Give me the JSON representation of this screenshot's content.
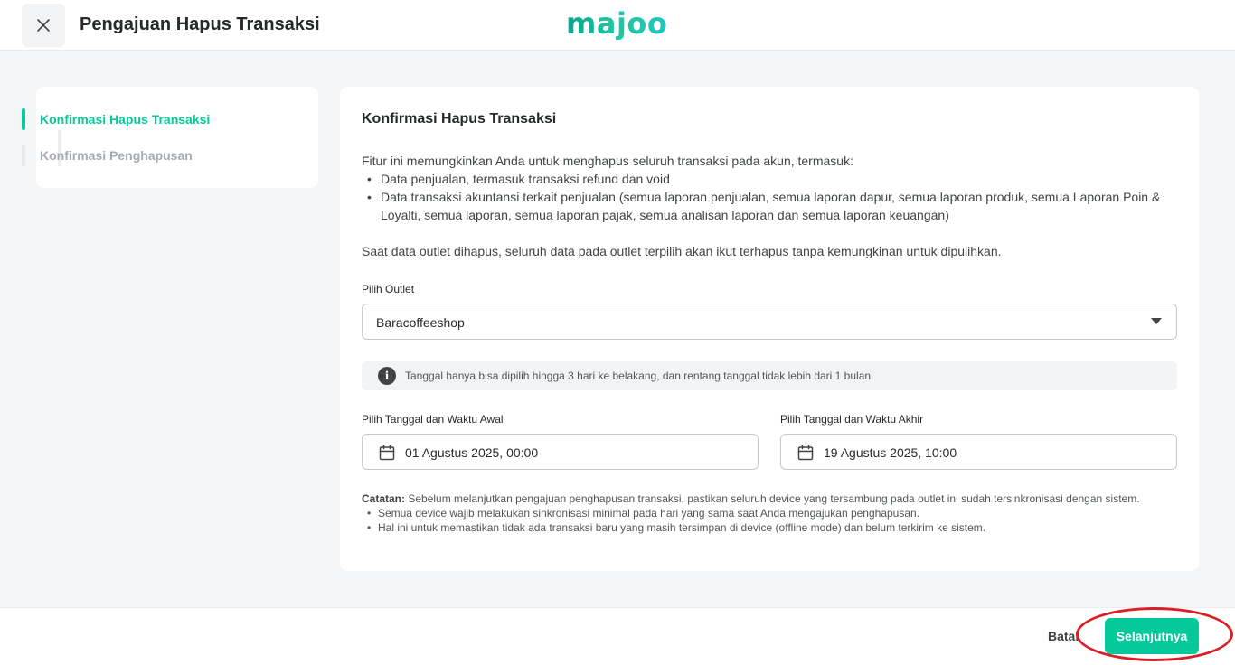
{
  "header": {
    "title": "Pengajuan Hapus Transaksi",
    "logo_text": "majoo",
    "brand_color": "#04c99b"
  },
  "stepper": {
    "steps": [
      {
        "label": "Konfirmasi Hapus Transaksi",
        "active": true
      },
      {
        "label": "Konfirmasi Penghapusan",
        "active": false
      }
    ]
  },
  "main": {
    "title": "Konfirmasi Hapus Transaksi",
    "intro": "Fitur ini memungkinkan Anda untuk menghapus seluruh transaksi pada akun, termasuk:",
    "bullets": [
      "Data penjualan, termasuk transaksi refund dan void",
      "Data transaksi akuntansi terkait penjualan (semua laporan penjualan, semua laporan dapur, semua laporan produk, semua Laporan Poin & Loyalti, semua laporan, semua laporan pajak, semua analisan laporan dan semua laporan keuangan)"
    ],
    "warning": "Saat data outlet dihapus, seluruh data pada outlet terpilih akan ikut terhapus tanpa kemungkinan untuk dipulihkan.",
    "outlet": {
      "label": "Pilih Outlet",
      "value": "Baracoffeeshop"
    },
    "info_banner": "Tanggal hanya bisa dipilih hingga 3 hari ke belakang, dan rentang tanggal tidak lebih dari 1 bulan",
    "start": {
      "label": "Pilih Tanggal dan Waktu Awal",
      "value": "01 Agustus 2025, 00:00"
    },
    "end": {
      "label": "Pilih Tanggal dan Waktu Akhir",
      "value": "19 Agustus 2025, 10:00"
    },
    "note": {
      "prefix": "Catatan:",
      "text": " Sebelum melanjutkan pengajuan penghapusan transaksi, pastikan seluruh device yang tersambung pada outlet ini sudah tersinkronisasi dengan sistem.",
      "items": [
        "Semua device wajib melakukan sinkronisasi minimal pada hari yang sama saat Anda mengajukan penghapusan.",
        "Hal ini untuk memastikan tidak ada transaksi baru yang masih tersimpan di device (offline mode) dan belum terkirim ke sistem."
      ]
    }
  },
  "footer": {
    "cancel_label": "Batal",
    "next_label": "Selanjutnya"
  },
  "icons": {
    "close": "close-icon",
    "dropdown": "chevron-down-icon",
    "info": "info-icon",
    "calendar": "calendar-icon"
  }
}
